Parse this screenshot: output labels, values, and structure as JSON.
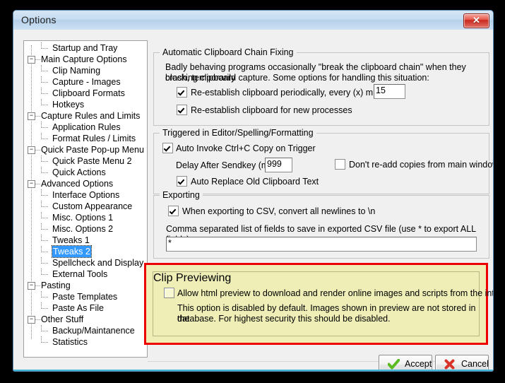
{
  "window": {
    "title": "Options",
    "close_label": "✕",
    "close_icon": "close-icon"
  },
  "sidebar": {
    "selected": "Tweaks 2",
    "items": [
      {
        "label": "Startup and Tray",
        "level": 1,
        "expander": ""
      },
      {
        "label": "Main Capture Options",
        "level": 0,
        "expander": "−"
      },
      {
        "label": "Clip Naming",
        "level": 1,
        "expander": ""
      },
      {
        "label": "Capture - Images",
        "level": 1,
        "expander": ""
      },
      {
        "label": "Clipboard Formats",
        "level": 1,
        "expander": ""
      },
      {
        "label": "Hotkeys",
        "level": 1,
        "expander": ""
      },
      {
        "label": "Capture Rules and Limits",
        "level": 0,
        "expander": "−"
      },
      {
        "label": "Application Rules",
        "level": 1,
        "expander": ""
      },
      {
        "label": "Format Rules / Limits",
        "level": 1,
        "expander": ""
      },
      {
        "label": "Quick Paste Pop-up Menu",
        "level": 0,
        "expander": "−"
      },
      {
        "label": "Quick Paste Menu 2",
        "level": 1,
        "expander": ""
      },
      {
        "label": "Quick Actions",
        "level": 1,
        "expander": ""
      },
      {
        "label": "Advanced Options",
        "level": 0,
        "expander": "−"
      },
      {
        "label": "Interface Options",
        "level": 1,
        "expander": ""
      },
      {
        "label": "Custom Appearance",
        "level": 1,
        "expander": ""
      },
      {
        "label": "Misc. Options 1",
        "level": 1,
        "expander": ""
      },
      {
        "label": "Misc. Options 2",
        "level": 1,
        "expander": ""
      },
      {
        "label": "Tweaks 1",
        "level": 1,
        "expander": ""
      },
      {
        "label": "Tweaks 2",
        "level": 1,
        "expander": ""
      },
      {
        "label": "Spellcheck and Display",
        "level": 1,
        "expander": ""
      },
      {
        "label": "External Tools",
        "level": 1,
        "expander": ""
      },
      {
        "label": "Pasting",
        "level": 0,
        "expander": "−"
      },
      {
        "label": "Paste Templates",
        "level": 1,
        "expander": ""
      },
      {
        "label": "Paste As File",
        "level": 1,
        "expander": ""
      },
      {
        "label": "Other Stuff",
        "level": 0,
        "expander": "−"
      },
      {
        "label": "Backup/Maintanence",
        "level": 1,
        "expander": ""
      },
      {
        "label": "Statistics",
        "level": 1,
        "expander": ""
      }
    ]
  },
  "groups": {
    "chain_fixing": {
      "legend": "Automatic Clipboard Chain Fixing",
      "description_line1": "Badly behaving programs occasionally \"break the clipboard chain\" when they crash, temporarily",
      "description_line2": "blocking clipboard capture.  Some options for handling this situation:",
      "checkbox_periodic": "Re-establish clipboard periodically, every (x) minutes:",
      "periodic_minutes": "15",
      "checkbox_new_processes": "Re-establish clipboard for new processes"
    },
    "triggered": {
      "legend": "Triggered in Editor/Spelling/Formatting",
      "checkbox_auto_invoke": "Auto Invoke Ctrl+C Copy on Trigger",
      "delay_label": "Delay After Sendkey (ms):",
      "delay_value": "999",
      "checkbox_no_readd": "Don't re-add copies from main window",
      "checkbox_auto_replace": "Auto Replace Old Clipboard Text"
    },
    "exporting": {
      "legend": "Exporting",
      "checkbox_convert_newlines": "When exporting to CSV, convert all newlines to \\n",
      "fields_label": "Comma separated list of fields to save in exported CSV file (use * to export ALL fields):",
      "fields_value": "*"
    },
    "clip_previewing": {
      "legend": "Clip Previewing",
      "checkbox_allow_html": "Allow html preview to download and render online images and scripts from the internet",
      "note_line1": "This option is disabled by default.  Images shown in preview are not stored in the",
      "note_line2": "database.  For highest security this should be disabled.",
      "highlight_color": "#ee0000",
      "background_color": "#eeeeb6"
    }
  },
  "footer": {
    "accept_label": "Accept",
    "accept_icon": "check-icon",
    "accept_color": "#5bbb22",
    "cancel_label": "Cancel",
    "cancel_icon": "x-mark-icon",
    "cancel_color": "#d8342b"
  }
}
